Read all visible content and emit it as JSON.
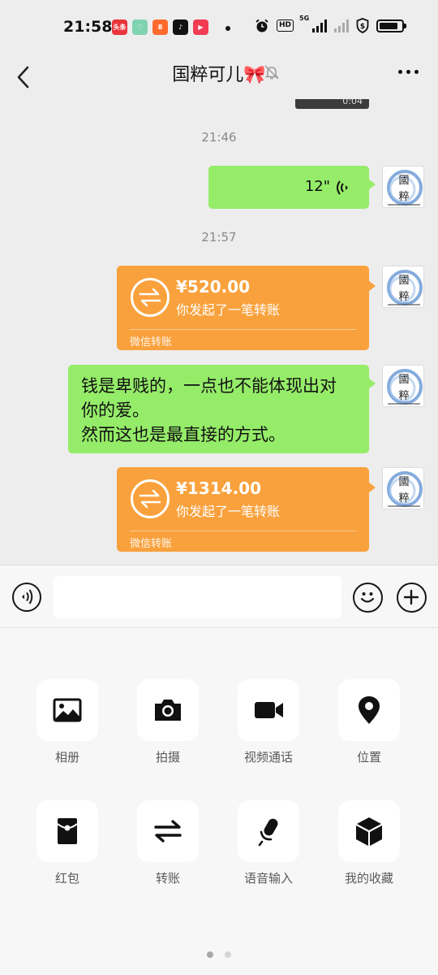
{
  "status_bar": {
    "time": "21:58",
    "app_icons": [
      {
        "name": "toutiao-icon",
        "label": "头条",
        "color": "#e8343a"
      },
      {
        "name": "heart-app-icon",
        "label": "♡",
        "color": "#7fd3b0"
      },
      {
        "name": "qq-icon",
        "label": "8",
        "color": "#ff6a2d"
      },
      {
        "name": "douyin-icon",
        "label": "♪",
        "color": "#111111"
      },
      {
        "name": "video-app-icon",
        "label": "▶",
        "color": "#f23c52"
      }
    ],
    "hd_label": "HD",
    "network": "5G",
    "battery_level": 0.85
  },
  "nav": {
    "title": "国粹可儿🎀",
    "back_icon": "chevron-left-icon",
    "mute_icon": "bell-off-icon",
    "more_icon": "more-icon"
  },
  "chat": {
    "video_duration": "0:04",
    "time_1": "21:46",
    "voice_message": {
      "duration": "12\""
    },
    "time_2": "21:57",
    "transfer_1": {
      "amount": "¥520.00",
      "desc": "你发起了一笔转账",
      "footer": "微信转账"
    },
    "text_message": {
      "line_1": "钱是卑贱的，一点也不能体现出对",
      "line_2": "你的爱。",
      "line_3": "然而这也是最直接的方式。"
    },
    "transfer_2": {
      "amount": "¥1314.00",
      "desc": "你发起了一笔转账",
      "footer": "微信转账"
    },
    "avatar_text": [
      "國",
      "粹"
    ]
  },
  "input_bar": {
    "voice_icon": "voice-toggle-icon",
    "emoji_icon": "emoji-icon",
    "plus_icon": "plus-icon",
    "value": ""
  },
  "panel": {
    "items": [
      {
        "label": "相册",
        "icon": "photo-album-icon"
      },
      {
        "label": "拍摄",
        "icon": "camera-icon"
      },
      {
        "label": "视频通话",
        "icon": "video-call-icon"
      },
      {
        "label": "位置",
        "icon": "location-icon"
      },
      {
        "label": "红包",
        "icon": "red-packet-icon"
      },
      {
        "label": "转账",
        "icon": "transfer-icon"
      },
      {
        "label": "语音输入",
        "icon": "microphone-icon"
      },
      {
        "label": "我的收藏",
        "icon": "favorites-icon"
      }
    ],
    "page": 1,
    "page_count": 2
  },
  "colors": {
    "chat_bg": "#ededed",
    "bubble_green": "#95ec69",
    "transfer_orange": "#f9a13c",
    "panel_bg": "#f7f7f7"
  }
}
